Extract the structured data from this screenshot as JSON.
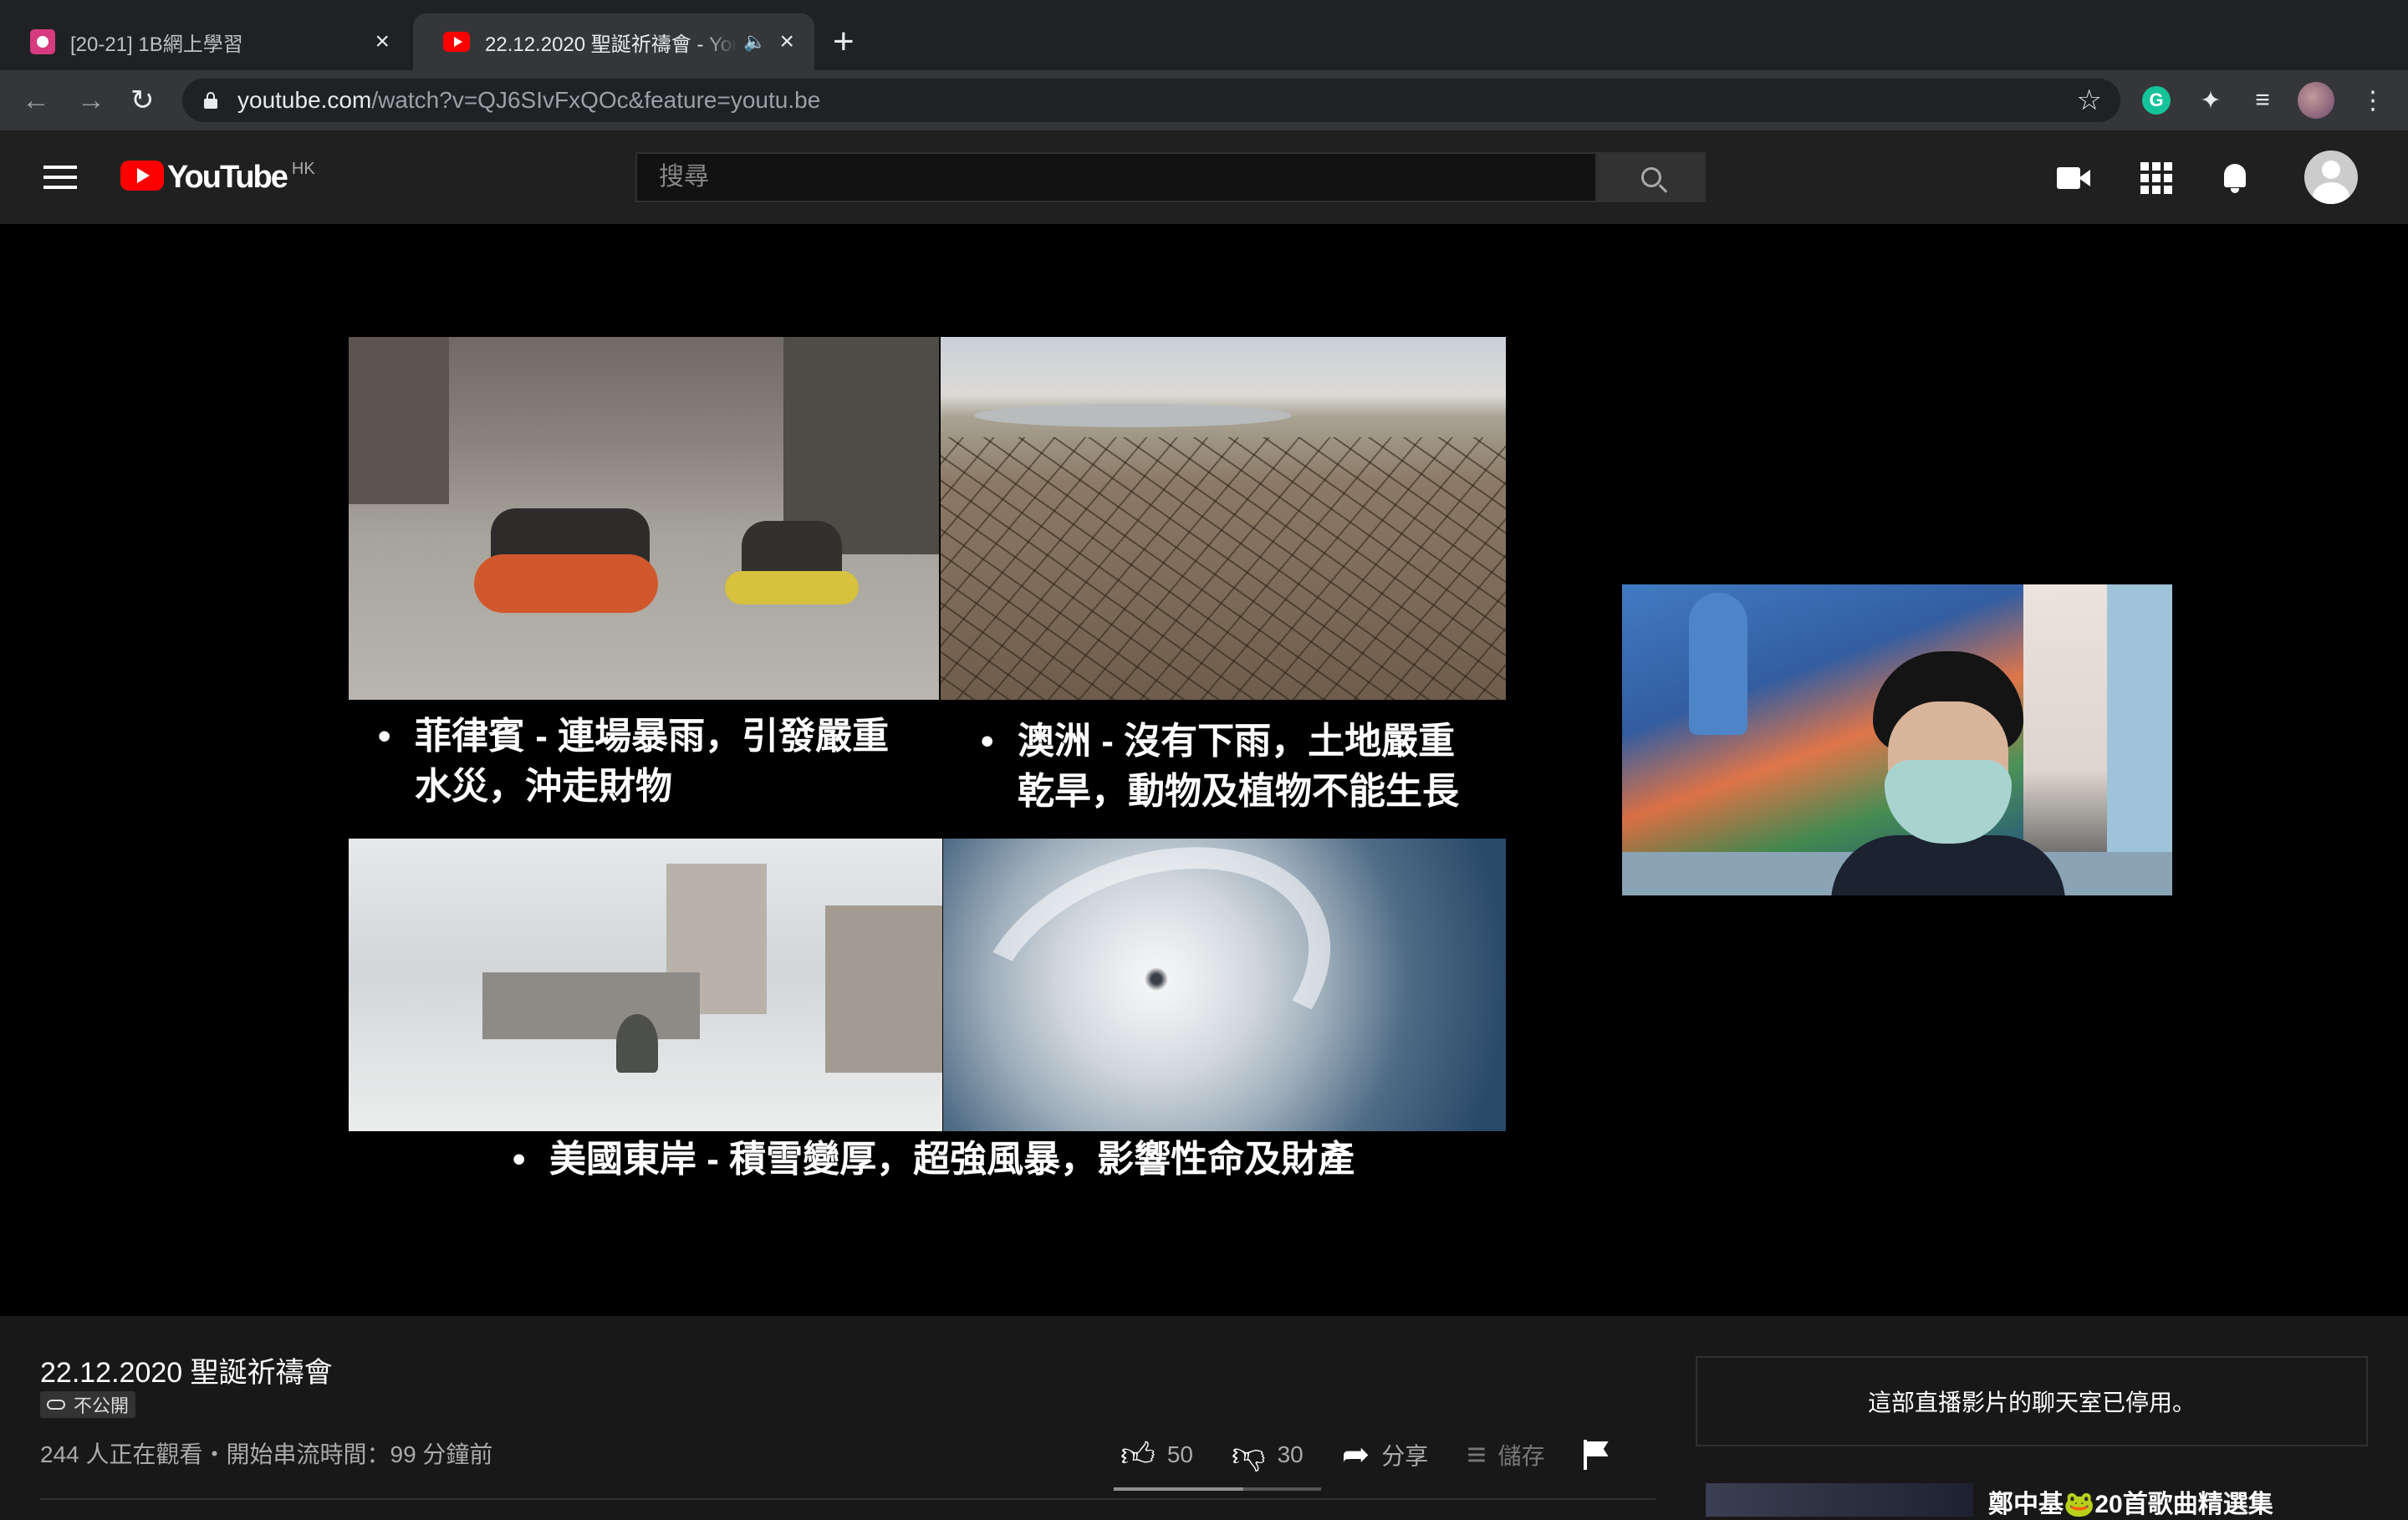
{
  "browser": {
    "tabs": [
      {
        "title": "[20-21] 1B網上學習"
      },
      {
        "title": "22.12.2020 聖誕祈禱會 - YouTube"
      }
    ],
    "url_host": "youtube.com",
    "url_path": "/watch?v=QJ6SIvFxQOc&feature=youtu.be"
  },
  "youtube": {
    "logo_text": "YouTube",
    "country_code": "HK",
    "search_placeholder": "搜尋"
  },
  "slide": {
    "caption_1_line1": "菲律賓 - 連場暴雨，引發嚴重",
    "caption_1_line2": "水災，沖走財物",
    "caption_2_line1": "澳洲 - 沒有下雨，土地嚴重",
    "caption_2_line2": "乾旱，動物及植物不能生長",
    "caption_3": "美國東岸 - 積雪變厚，超強風暴，影響性命及財產"
  },
  "video": {
    "title": "22.12.2020 聖誕祈禱會",
    "visibility": "不公開",
    "meta": "244 人正在觀看・開始串流時間：99 分鐘前",
    "likes": "50",
    "dislikes": "30",
    "share_label": "分享",
    "save_label": "儲存",
    "like_ratio": 0.625
  },
  "chat": {
    "disabled_message": "這部直播影片的聊天室已停用。"
  },
  "up_next": {
    "title": "鄭中基🐸20首歌曲精選集"
  }
}
